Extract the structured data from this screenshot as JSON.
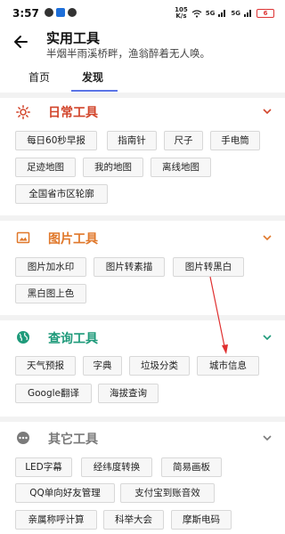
{
  "status_bar": {
    "time": "3:57",
    "speed_top": "105",
    "speed_bottom": "K/s",
    "sig1": "5G",
    "sig2": "5G",
    "battery": "6",
    "battery_color": "#d33333"
  },
  "header": {
    "title": "实用工具",
    "subtitle": "半烟半雨溪桥畔，渔翁醉着无人唤。"
  },
  "tabs": [
    {
      "label": "首页"
    },
    {
      "label": "发现"
    }
  ],
  "colors": {
    "daily": "#d2452b",
    "image": "#e0782b",
    "query": "#1e9a7a",
    "other": "#7a7a7a",
    "accent": "#5b74e6"
  },
  "sections": {
    "daily": {
      "title": "日常工具",
      "icon": "sun-icon",
      "items": [
        "每日60秒早报",
        "指南针",
        "尺子",
        "手电筒",
        "足迹地图",
        "我的地图",
        "离线地图",
        "全国省市区轮廓"
      ]
    },
    "image": {
      "title": "图片工具",
      "icon": "image-icon",
      "items": [
        "图片加水印",
        "图片转素描",
        "图片转黑白",
        "黑白图上色"
      ]
    },
    "query": {
      "title": "查询工具",
      "icon": "globe-icon",
      "items": [
        "天气预报",
        "字典",
        "垃圾分类",
        "城市信息",
        "Google翻译",
        "海拔查询"
      ]
    },
    "other": {
      "title": "其它工具",
      "icon": "more-icon",
      "items": [
        "LED字幕",
        "经纬度转换",
        "简易画板",
        "QQ单向好友管理",
        "支付宝到账音效",
        "亲属称呼计算",
        "科举大会",
        "摩斯电码"
      ]
    }
  }
}
